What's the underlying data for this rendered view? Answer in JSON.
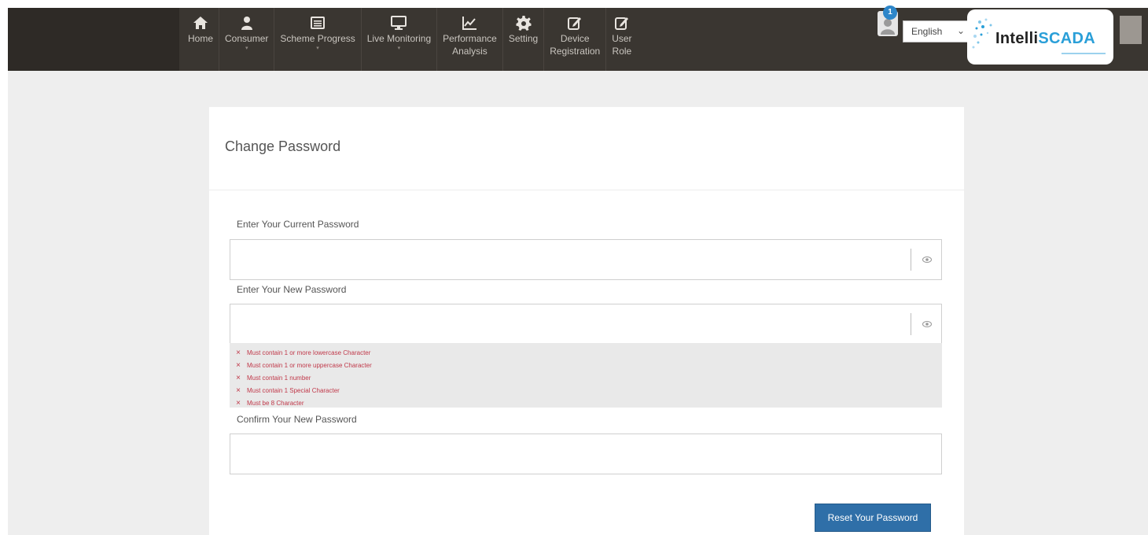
{
  "nav": {
    "items": [
      {
        "label": "Home",
        "line2": "",
        "icon": "home-icon",
        "caret": false
      },
      {
        "label": "Consumer",
        "line2": "",
        "icon": "user-icon",
        "caret": true
      },
      {
        "label": "Scheme Progress",
        "line2": "",
        "icon": "list-icon",
        "caret": true
      },
      {
        "label": "Live Monitoring",
        "line2": "",
        "icon": "monitor-icon",
        "caret": true
      },
      {
        "label": "Performance",
        "line2": "Analysis",
        "icon": "chart-icon",
        "caret": false
      },
      {
        "label": "Setting",
        "line2": "",
        "icon": "gear-icon",
        "caret": false
      },
      {
        "label": "Device",
        "line2": "Registration",
        "icon": "edit-icon",
        "caret": false
      },
      {
        "label": "User",
        "line2": "Role",
        "icon": "edit-icon",
        "caret": false
      }
    ],
    "caret_glyph": "▾",
    "notification_count": "1",
    "language": "English",
    "brand_part1": "Intelli",
    "brand_part2": "SCADA"
  },
  "colors": {
    "navbar": "#3a3631",
    "accent": "#2f6fa8",
    "error": "#c0394a"
  },
  "form": {
    "title": "Change Password",
    "current_label": "Enter Your Current Password",
    "current_value": "",
    "new_label": "Enter Your New Password",
    "new_value": "",
    "confirm_label": "Confirm Your New Password",
    "confirm_value": "",
    "rules": [
      "Must contain 1 or more lowercase Character",
      "Must contain 1 or more uppercase Character",
      "Must contain 1 number",
      "Must contain 1 Special Character",
      "Must be 8 Character"
    ],
    "rule_mark": "×",
    "submit_label": "Reset Your Password"
  }
}
